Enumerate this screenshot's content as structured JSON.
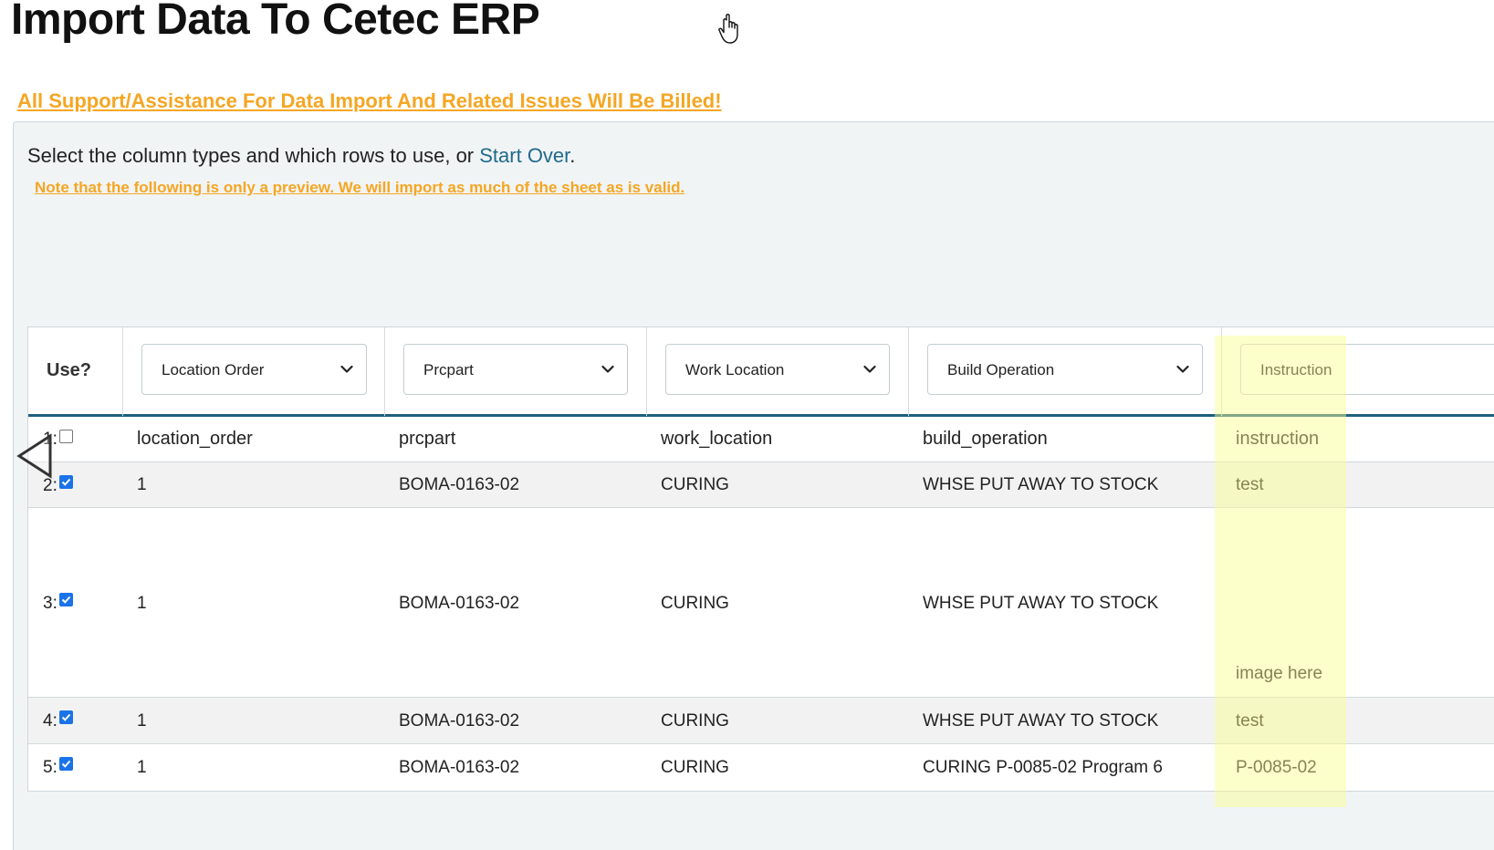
{
  "page": {
    "title": "Import Data To Cetec ERP",
    "billing_warning": "All Support/Assistance For Data Import And Related Issues Will Be Billed!"
  },
  "instructions": {
    "prefix": "Select the column types and which rows to use, or ",
    "start_over": "Start Over",
    "suffix": ".",
    "preview_note": "Note that the following is only a preview. We will import as much of the sheet as is valid."
  },
  "table": {
    "use_header": "Use?",
    "columns": [
      {
        "selected": "Location Order"
      },
      {
        "selected": "Prcpart"
      },
      {
        "selected": "Work Location"
      },
      {
        "selected": "Build Operation"
      },
      {
        "selected": "Instruction"
      }
    ],
    "rows": [
      {
        "num": "1:",
        "checked": false,
        "cells": [
          "location_order",
          "prcpart",
          "work_location",
          "build_operation",
          "instruction"
        ]
      },
      {
        "num": "2:",
        "checked": true,
        "cells": [
          "1",
          "BOMA-0163-02",
          "CURING",
          "WHSE PUT AWAY TO STOCK",
          "test"
        ]
      },
      {
        "num": "3:",
        "checked": true,
        "cells": [
          "1",
          "BOMA-0163-02",
          "CURING",
          "WHSE PUT AWAY TO STOCK",
          "image here"
        ]
      },
      {
        "num": "4:",
        "checked": true,
        "cells": [
          "1",
          "BOMA-0163-02",
          "CURING",
          "WHSE PUT AWAY TO STOCK",
          "test"
        ]
      },
      {
        "num": "5:",
        "checked": true,
        "cells": [
          "1",
          "BOMA-0163-02",
          "CURING",
          "CURING P-0085-02 Program 6",
          "P-0085-02"
        ]
      }
    ]
  },
  "colors": {
    "accent_orange": "#f5a623",
    "link_blue": "#1f6a8a",
    "header_rule": "#1f5f80",
    "checkbox_blue": "#1a73e8",
    "highlight_yellow": "#faff8c"
  },
  "icons": {
    "cursor": "hand-pointer-icon",
    "scroll": "chevron-left-icon",
    "dropdown": "chevron-down-icon",
    "check": "check-icon"
  }
}
